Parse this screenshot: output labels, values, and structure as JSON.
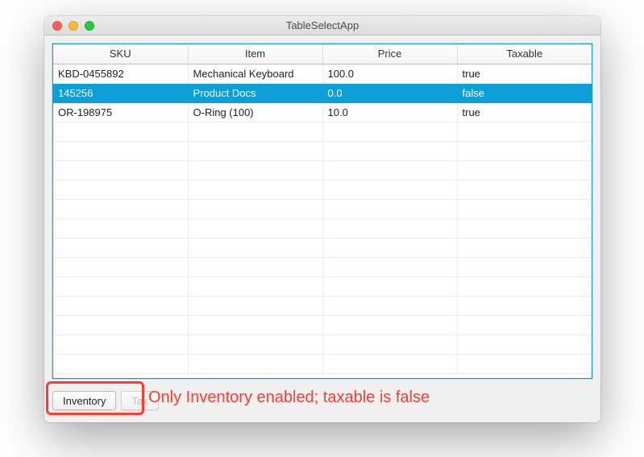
{
  "window": {
    "title": "TableSelectApp"
  },
  "table": {
    "columns": [
      "SKU",
      "Item",
      "Price",
      "Taxable"
    ],
    "rows": [
      {
        "sku": "KBD-0455892",
        "item": "Mechanical Keyboard",
        "price": "100.0",
        "taxable": "true",
        "selected": false
      },
      {
        "sku": "145256",
        "item": "Product Docs",
        "price": "0.0",
        "taxable": "false",
        "selected": true
      },
      {
        "sku": "OR-198975",
        "item": "O-Ring (100)",
        "price": "10.0",
        "taxable": "true",
        "selected": false
      }
    ],
    "empty_row_count": 13
  },
  "toolbar": {
    "inventory_label": "Inventory",
    "inventory_enabled": true,
    "tax_label": "Tax",
    "tax_enabled": false
  },
  "annotation": {
    "text": "Only Inventory enabled; taxable is false"
  }
}
